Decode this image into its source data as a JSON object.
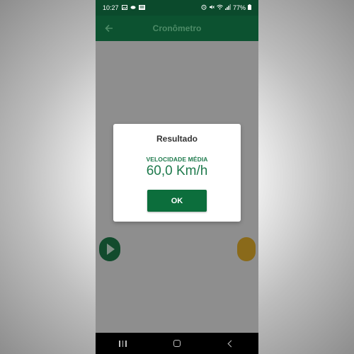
{
  "status_bar": {
    "time": "10:27",
    "battery": "77%",
    "left_icons": [
      "gallery-icon",
      "cloud-icon",
      "news-icon"
    ],
    "right_icons": [
      "alarm-icon",
      "mute-icon",
      "wifi-icon",
      "signal-icon",
      "battery-icon"
    ]
  },
  "app_bar": {
    "title": "Cronômetro",
    "back_icon": "arrow-left-icon"
  },
  "dialog": {
    "title": "Resultado",
    "label": "VELOCIDADE MÉDIA",
    "value": "60,0 Km/h",
    "ok_label": "OK"
  },
  "colors": {
    "primary": "#0c6e3c",
    "accent_text": "#1e7a4c",
    "app_bar": "#0c5230",
    "status_bar": "#0b4a2c"
  }
}
